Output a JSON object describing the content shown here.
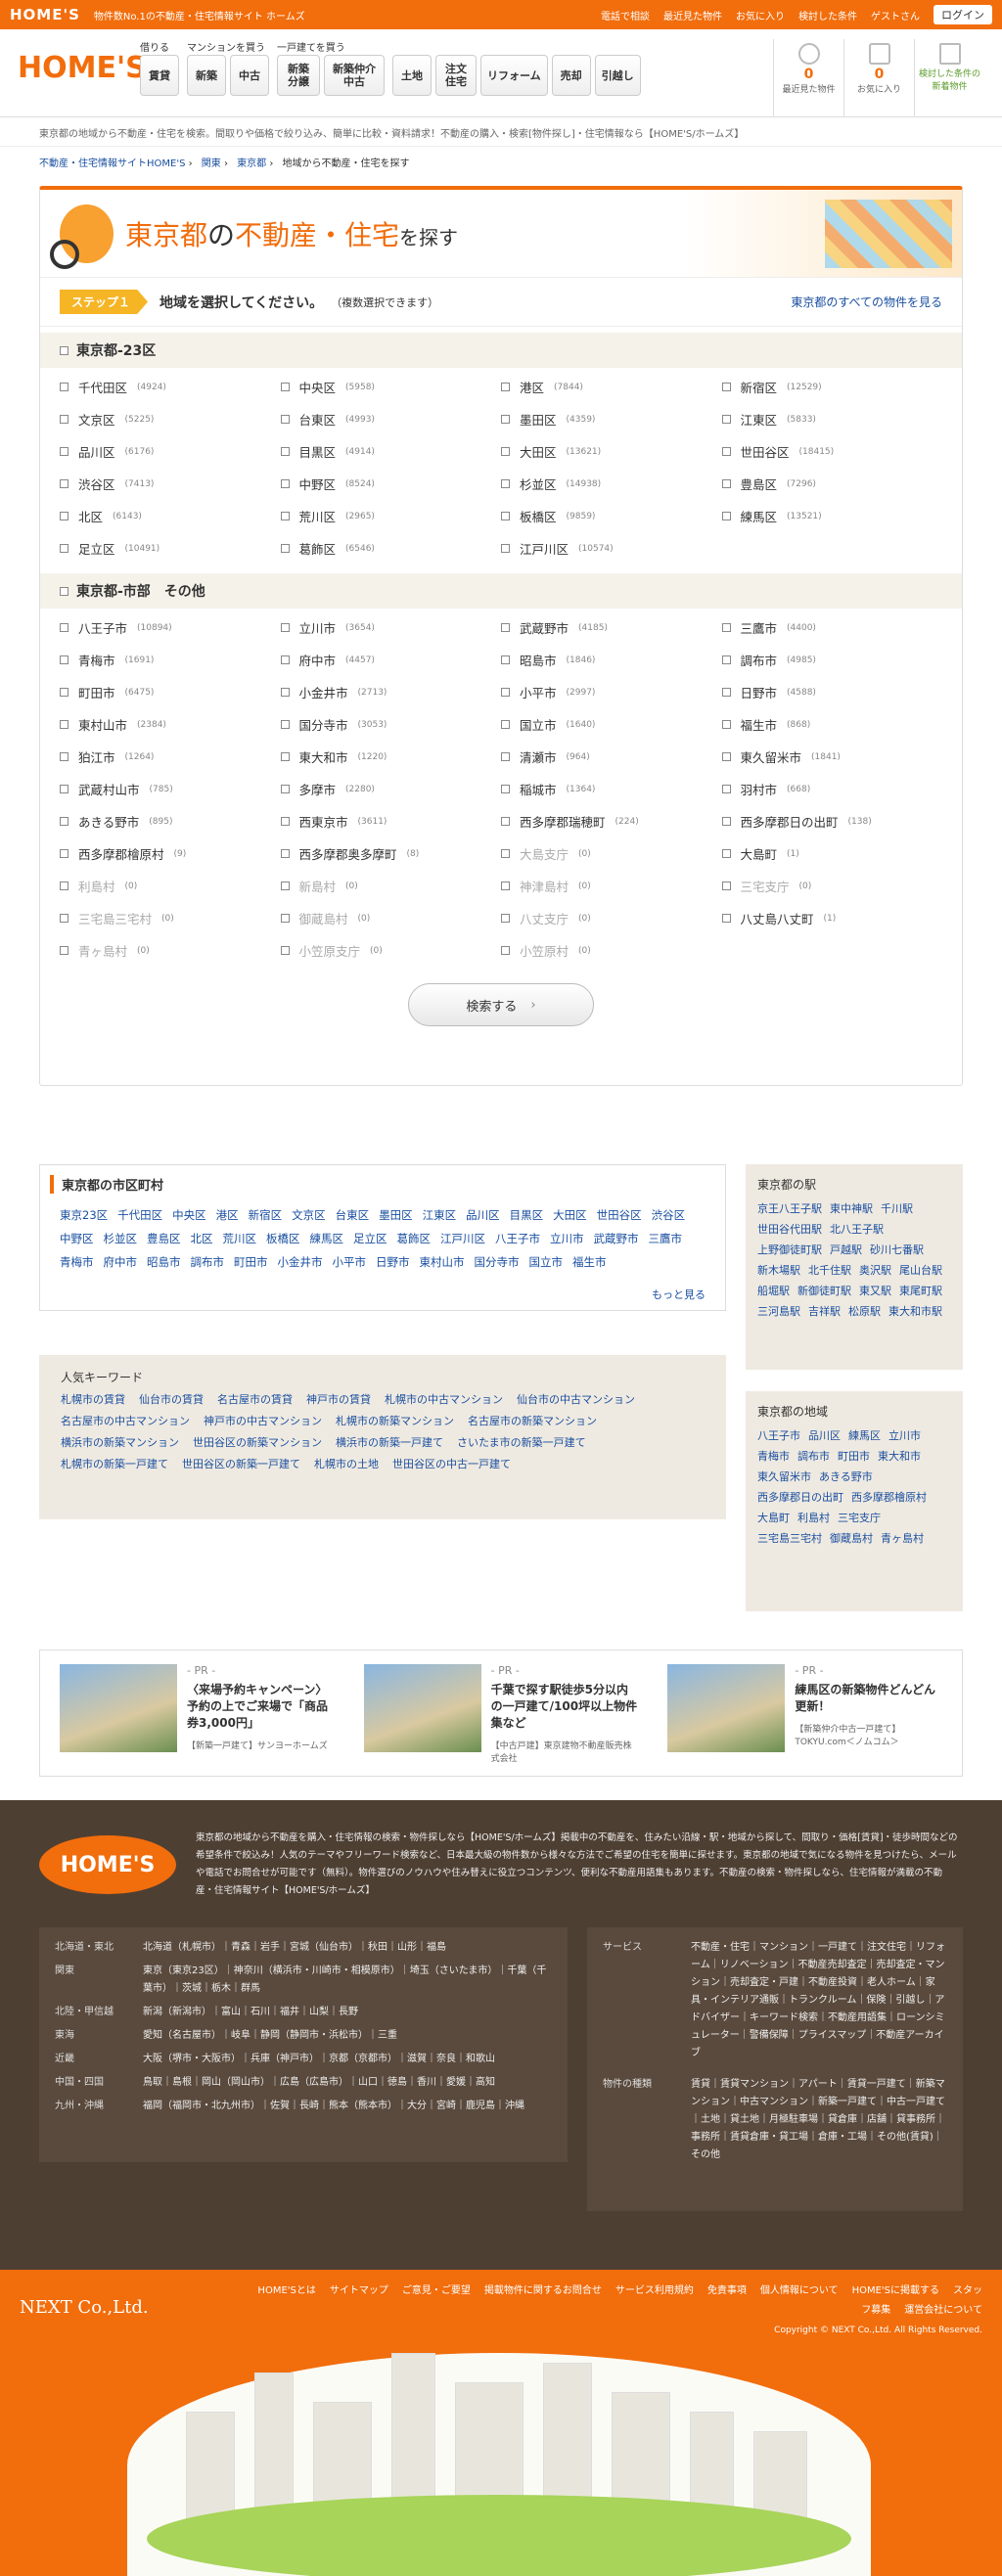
{
  "topbar": {
    "logo": "HOME'S",
    "tagline": "物件数No.1の不動産・住宅情報サイト ホームズ",
    "phone": "電話で相談",
    "recent": "最近見た物件",
    "favorites": "お気に入り",
    "saved": "検討した条件",
    "guest": "ゲストさん",
    "login": "ログイン"
  },
  "header": {
    "logo": "HOME'S",
    "groups": [
      {
        "cap": "借りる",
        "btns": [
          "賃貸"
        ]
      },
      {
        "cap": "マンションを買う",
        "btns": [
          "新築",
          "中古"
        ]
      },
      {
        "cap": "一戸建てを買う",
        "btns": [
          "新築分譲",
          "新築仲介中古"
        ]
      },
      {
        "cap": "",
        "btns": [
          "土地",
          "注文住宅",
          "リフォーム",
          "売却",
          "引越し"
        ]
      }
    ],
    "utils": [
      {
        "num": "0",
        "label": "最近見た物件"
      },
      {
        "num": "0",
        "label": "お気に入り"
      },
      {
        "num": "",
        "label": "検討した条件の新着物件"
      }
    ]
  },
  "lead": "東京都の地域から不動産・住宅を検索。間取りや価格で絞り込み、簡単に比較・資料請求！不動産の購入・検索[物件探し]・住宅情報なら【HOME'S/ホームズ】",
  "crumb": [
    "不動産・住宅情報サイトHOME'S",
    "関東",
    "東京都",
    "地域から不動産・住宅を探す"
  ],
  "title": {
    "pref": "東京都",
    "mid": "の",
    "hl": "不動産・住宅",
    "tail": "を探す"
  },
  "step": {
    "badge": "ステップ１",
    "msg": "地域を選択してください。",
    "note": "（複数選択できます）",
    "all": "東京都のすべての物件を見る"
  },
  "wards": {
    "head": "東京都-23区",
    "items": [
      [
        "千代田区",
        "(4924)"
      ],
      [
        "中央区",
        "(5958)"
      ],
      [
        "港区",
        "(7844)"
      ],
      [
        "新宿区",
        "(12529)"
      ],
      [
        "文京区",
        "(5225)"
      ],
      [
        "台東区",
        "(4993)"
      ],
      [
        "墨田区",
        "(4359)"
      ],
      [
        "江東区",
        "(5833)"
      ],
      [
        "品川区",
        "(6176)"
      ],
      [
        "目黒区",
        "(4914)"
      ],
      [
        "大田区",
        "(13621)"
      ],
      [
        "世田谷区",
        "(18415)"
      ],
      [
        "渋谷区",
        "(7413)"
      ],
      [
        "中野区",
        "(8524)"
      ],
      [
        "杉並区",
        "(14938)"
      ],
      [
        "豊島区",
        "(7296)"
      ],
      [
        "北区",
        "(6143)"
      ],
      [
        "荒川区",
        "(2965)"
      ],
      [
        "板橋区",
        "(9859)"
      ],
      [
        "練馬区",
        "(13521)"
      ],
      [
        "足立区",
        "(10491)"
      ],
      [
        "葛飾区",
        "(6546)"
      ],
      [
        "江戸川区",
        "(10574)"
      ]
    ]
  },
  "cities": {
    "head": "東京都-市部　その他",
    "items": [
      [
        "八王子市",
        "(10894)"
      ],
      [
        "立川市",
        "(3654)"
      ],
      [
        "武蔵野市",
        "(4185)"
      ],
      [
        "三鷹市",
        "(4400)"
      ],
      [
        "青梅市",
        "(1691)"
      ],
      [
        "府中市",
        "(4457)"
      ],
      [
        "昭島市",
        "(1846)"
      ],
      [
        "調布市",
        "(4985)"
      ],
      [
        "町田市",
        "(6475)"
      ],
      [
        "小金井市",
        "(2713)"
      ],
      [
        "小平市",
        "(2997)"
      ],
      [
        "日野市",
        "(4588)"
      ],
      [
        "東村山市",
        "(2384)"
      ],
      [
        "国分寺市",
        "(3053)"
      ],
      [
        "国立市",
        "(1640)"
      ],
      [
        "福生市",
        "(868)"
      ],
      [
        "狛江市",
        "(1264)"
      ],
      [
        "東大和市",
        "(1220)"
      ],
      [
        "清瀬市",
        "(964)"
      ],
      [
        "東久留米市",
        "(1841)"
      ],
      [
        "武蔵村山市",
        "(785)"
      ],
      [
        "多摩市",
        "(2280)"
      ],
      [
        "稲城市",
        "(1364)"
      ],
      [
        "羽村市",
        "(668)"
      ],
      [
        "あきる野市",
        "(895)"
      ],
      [
        "西東京市",
        "(3611)"
      ],
      [
        "西多摩郡瑞穂町",
        "(224)"
      ],
      [
        "西多摩郡日の出町",
        "(138)"
      ],
      [
        "西多摩郡檜原村",
        "(9)"
      ],
      [
        "西多摩郡奥多摩町",
        "(8)"
      ],
      [
        "大島支庁",
        "(0)"
      ],
      [
        "大島町",
        "(1)"
      ],
      [
        "利島村",
        "(0)"
      ],
      [
        "新島村",
        "(0)"
      ],
      [
        "神津島村",
        "(0)"
      ],
      [
        "三宅支庁",
        "(0)"
      ],
      [
        "三宅島三宅村",
        "(0)"
      ],
      [
        "御蔵島村",
        "(0)"
      ],
      [
        "八丈支庁",
        "(0)"
      ],
      [
        "八丈島八丈町",
        "(1)"
      ],
      [
        "青ヶ島村",
        "(0)"
      ],
      [
        "小笠原支庁",
        "(0)"
      ],
      [
        "小笠原村",
        "(0)"
      ]
    ]
  },
  "search_btn": "検索する",
  "muni": {
    "head": "東京都の市区町村",
    "links": [
      "東京23区",
      "千代田区",
      "中央区",
      "港区",
      "新宿区",
      "文京区",
      "台東区",
      "墨田区",
      "江東区",
      "品川区",
      "目黒区",
      "大田区",
      "世田谷区",
      "渋谷区",
      "中野区",
      "杉並区",
      "豊島区",
      "北区",
      "荒川区",
      "板橋区",
      "練馬区",
      "足立区",
      "葛飾区",
      "江戸川区",
      "八王子市",
      "立川市",
      "武蔵野市",
      "三鷹市",
      "青梅市",
      "府中市",
      "昭島市",
      "調布市",
      "町田市",
      "小金井市",
      "小平市",
      "日野市",
      "東村山市",
      "国分寺市",
      "国立市",
      "福生市"
    ],
    "more": "もっと見る"
  },
  "kw": {
    "head": "人気キーワード",
    "links": [
      "札幌市の賃貸",
      "仙台市の賃貸",
      "名古屋市の賃貸",
      "神戸市の賃貸",
      "札幌市の中古マンション",
      "仙台市の中古マンション",
      "名古屋市の中古マンション",
      "神戸市の中古マンション",
      "札幌市の新築マンション",
      "名古屋市の新築マンション",
      "横浜市の新築マンション",
      "世田谷区の新築マンション",
      "横浜市の新築一戸建て",
      "さいたま市の新築一戸建て",
      "札幌市の新築一戸建て",
      "世田谷区の新築一戸建て",
      "札幌市の土地",
      "世田谷区の中古一戸建て"
    ]
  },
  "side1": {
    "head": "東京都の駅",
    "links": [
      "京王八王子駅",
      "東中神駅",
      "千川駅",
      "世田谷代田駅",
      "北八王子駅",
      "上野御徒町駅",
      "戸越駅",
      "砂川七番駅",
      "新木場駅",
      "北千住駅",
      "奥沢駅",
      "尾山台駅",
      "船堀駅",
      "新御徒町駅",
      "東又駅",
      "東尾町駅",
      "三河島駅",
      "吉祥駅",
      "松原駅",
      "東大和市駅"
    ]
  },
  "side2": {
    "head": "東京都の地域",
    "links": [
      "八王子市",
      "品川区",
      "練馬区",
      "立川市",
      "青梅市",
      "調布市",
      "町田市",
      "東大和市",
      "東久留米市",
      "あきる野市",
      "西多摩郡日の出町",
      "西多摩郡檜原村",
      "大島町",
      "利島村",
      "三宅支庁",
      "三宅島三宅村",
      "御蔵島村",
      "青ヶ島村"
    ]
  },
  "pr": [
    {
      "lab": "- PR -",
      "head": "〈来場予約キャンペーン〉予約の上でご来場で「商品券3,000円」",
      "sub": "【新築一戸建て】サンヨーホームズ"
    },
    {
      "lab": "- PR -",
      "head": "千葉で探す駅徒歩5分以内の一戸建て/100坪以上物件集など",
      "sub": "【中古戸建】東京建物不動産販売株式会社"
    },
    {
      "lab": "- PR -",
      "head": "練馬区の新築物件どんどん更新！",
      "sub": "【新築仲介中古一戸建て】TOKYU.com＜ノムコム＞"
    }
  ],
  "foot": {
    "logo": "HOME'S",
    "about": "東京都の地域から不動産を購入・住宅情報の検索・物件探しなら【HOME'S/ホームズ】掲載中の不動産を、住みたい沿線・駅・地域から探して、間取り・価格[賃貸]・徒歩時間などの希望条件で絞込み！人気のテーマやフリーワード検索など、日本最大級の物件数から様々な方法でご希望の住宅を簡単に探せます。東京都の地域で気になる物件を見つけたら、メールや電話でお問合せが可能です（無料）。物件選びのノウハウや住み替えに役立つコンテンツ、便利な不動産用語集もあります。不動産の検索・物件探しなら、住宅情報が満載の不動産・住宅情報サイト【HOME'S/ホームズ】",
    "regions": [
      [
        "北海道・東北",
        "北海道（札幌市）｜青森｜岩手｜宮城（仙台市）｜秋田｜山形｜福島"
      ],
      [
        "関東",
        "東京（東京23区）｜神奈川（横浜市・川崎市・相模原市）｜埼玉（さいたま市）｜千葉（千葉市）｜茨城｜栃木｜群馬"
      ],
      [
        "北陸・甲信越",
        "新潟（新潟市）｜富山｜石川｜福井｜山梨｜長野"
      ],
      [
        "東海",
        "愛知（名古屋市）｜岐阜｜静岡（静岡市・浜松市）｜三重"
      ],
      [
        "近畿",
        "大阪（堺市・大阪市）｜兵庫（神戸市）｜京都（京都市）｜滋賀｜奈良｜和歌山"
      ],
      [
        "中国・四国",
        "鳥取｜島根｜岡山（岡山市）｜広島（広島市）｜山口｜徳島｜香川｜愛媛｜高知"
      ],
      [
        "九州・沖縄",
        "福岡（福岡市・北九州市）｜佐賀｜長崎｜熊本（熊本市）｜大分｜宮崎｜鹿児島｜沖縄"
      ]
    ],
    "service_head": "サービス",
    "service": "不動産・住宅｜マンション｜一戸建て｜注文住宅｜リフォーム｜リノベーション｜不動産売却査定｜売却査定・マンション｜売却査定・戸建｜不動産投資｜老人ホーム｜家具・インテリア通販｜トランクルーム｜保険｜引越し｜アドバイザー｜キーワード検索｜不動産用語集｜ローンシミュレーター｜警備保障｜プライスマップ｜不動産アーカイブ",
    "kind_head": "物件の種類",
    "kind": "賃貸｜賃貸マンション｜アパート｜賃貸一戸建て｜新築マンション｜中古マンション｜新築一戸建て｜中古一戸建て｜土地｜貸土地｜月極駐車場｜貸倉庫｜店舗｜貸事務所｜事務所｜賃貸倉庫・貸工場｜倉庫・工場｜その他(賃貸)｜その他"
  },
  "bottom": {
    "company": "NEXT Co.,Ltd.",
    "links": [
      "HOME'Sとは",
      "サイトマップ",
      "ご意見・ご要望",
      "掲載物件に関するお問合せ",
      "サービス利用規約",
      "免責事項",
      "個人情報について",
      "HOME'Sに掲載する",
      "スタッフ募集",
      "運営会社について"
    ],
    "copy": "Copyright © NEXT Co.,Ltd. All Rights Reserved."
  }
}
